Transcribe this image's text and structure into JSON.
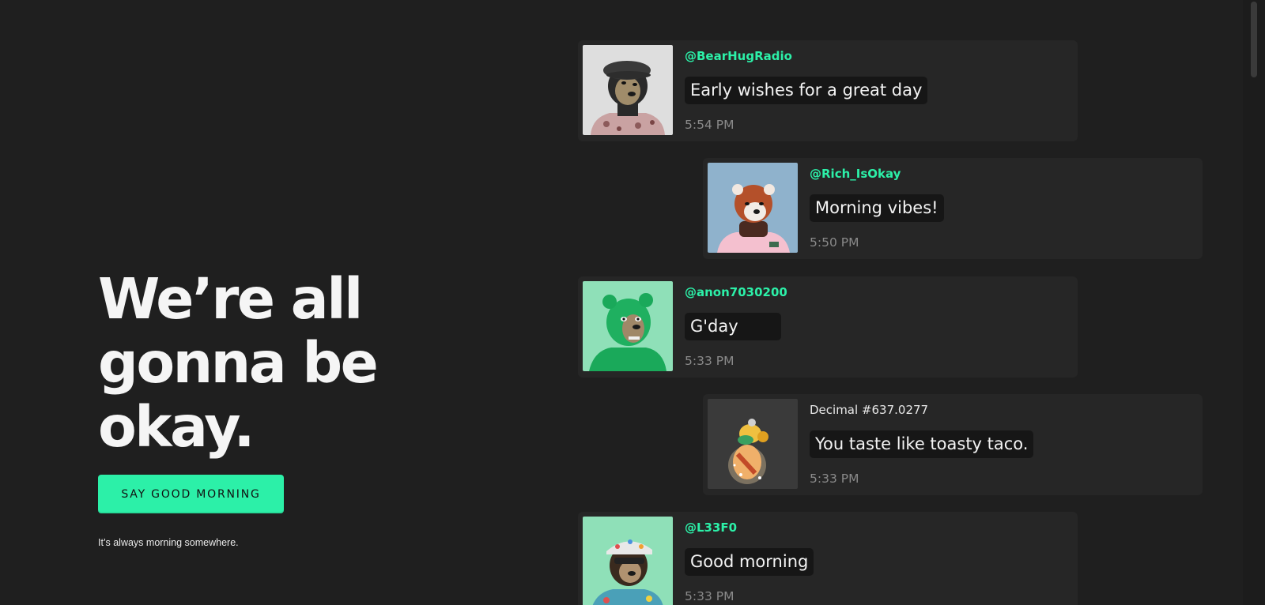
{
  "hero": {
    "headline": "We’re all gonna be okay.",
    "cta_label": "SAY GOOD MORNING",
    "tagline": "It’s always morning somewhere."
  },
  "colors": {
    "background": "#1f1f1f",
    "card": "#262626",
    "accent": "#2cf0a8",
    "timestamp": "#8a8a8a"
  },
  "messages": [
    {
      "handle": "@BearHugRadio",
      "text": "Early wishes for a great day",
      "time": "5:54 PM",
      "avatar": "bear-flatcap-avatar"
    },
    {
      "handle": "@Rich_IsOkay",
      "text": "Morning vibes!",
      "time": "5:50 PM",
      "avatar": "red-panda-avatar"
    },
    {
      "handle": "@anon7030200",
      "text": "G'day",
      "time": "5:33 PM",
      "avatar": "green-bear-avatar"
    },
    {
      "handle": "Decimal #637.0277",
      "text": "You taste like toasty taco.",
      "time": "5:33 PM",
      "avatar": "taco-creature-avatar"
    },
    {
      "handle": "@L33F0",
      "text": "Good morning",
      "time": "5:33 PM",
      "avatar": "bear-floral-cap-avatar"
    }
  ]
}
